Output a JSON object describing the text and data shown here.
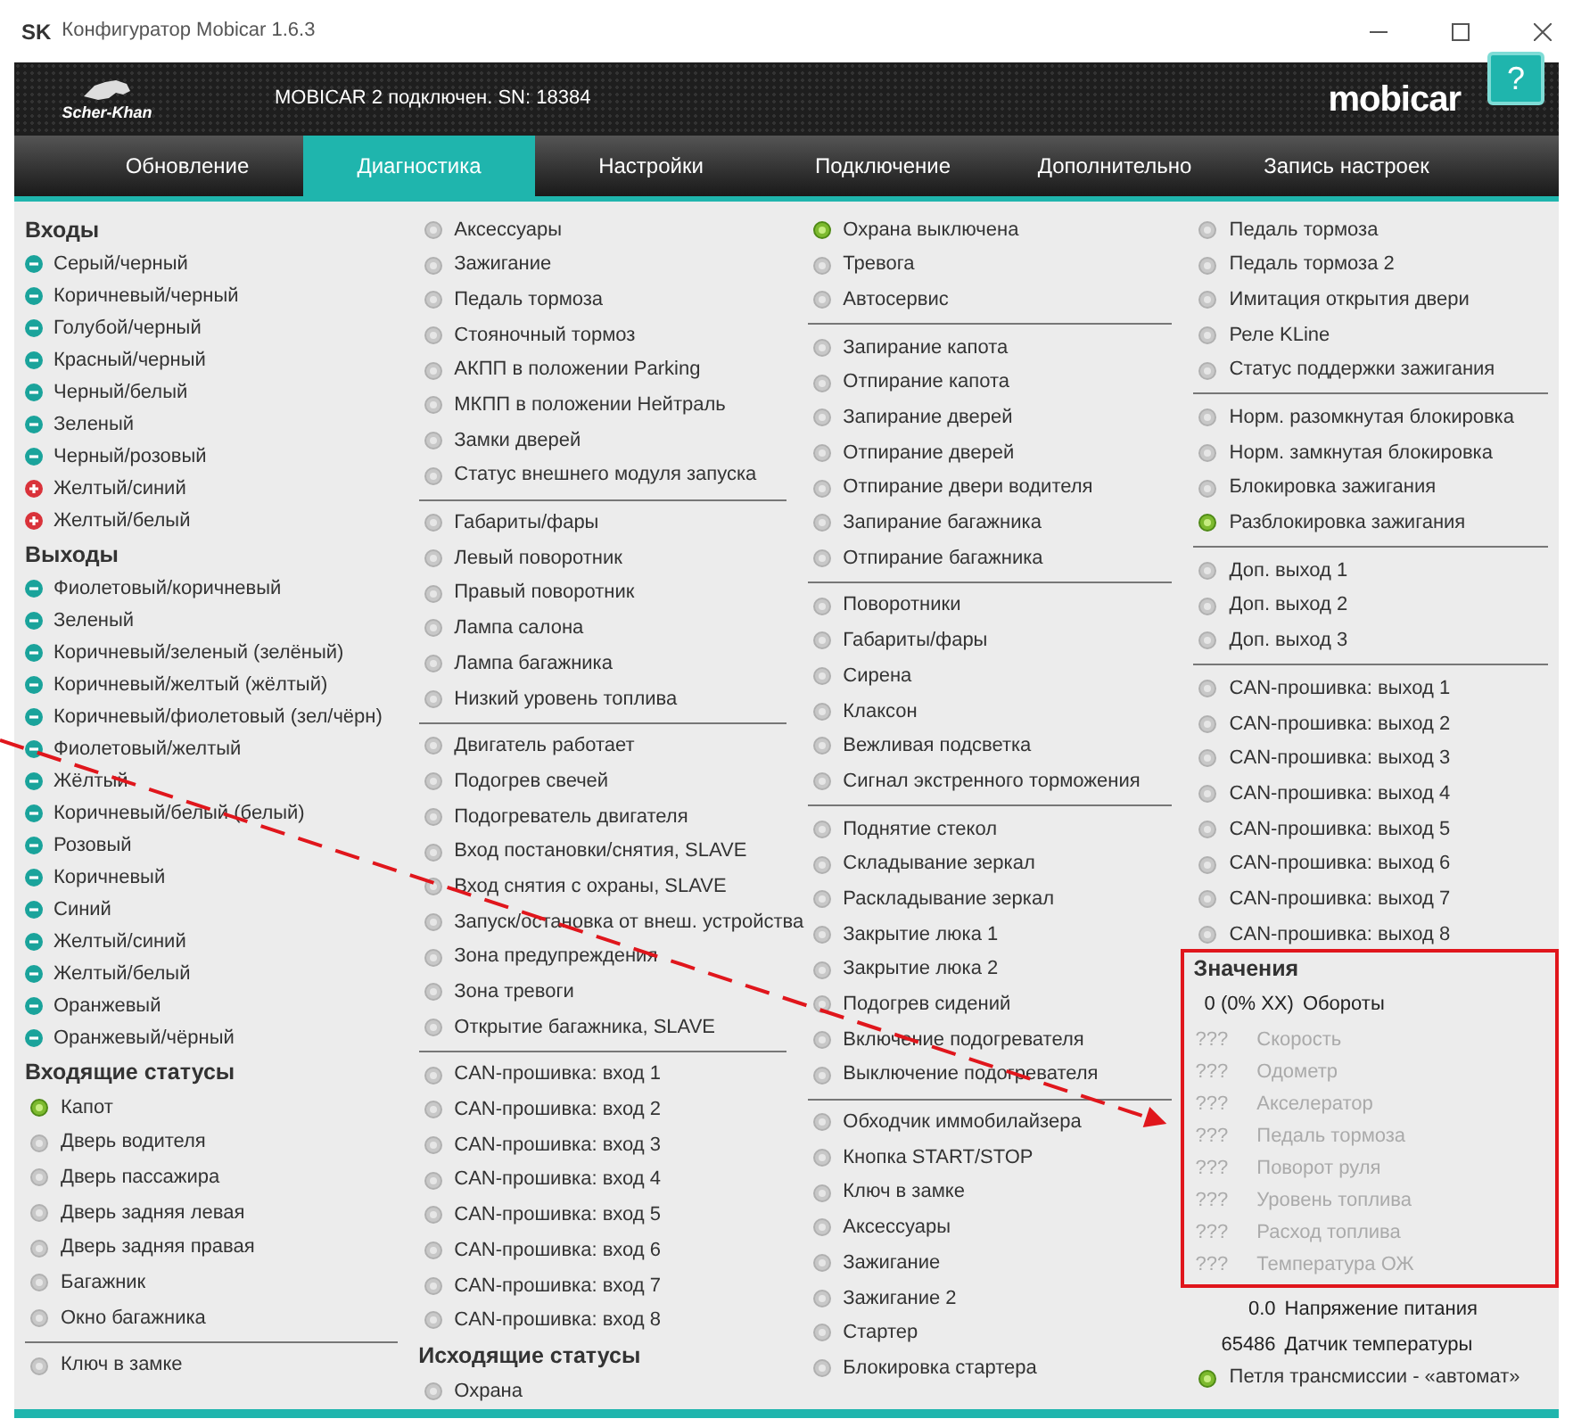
{
  "window": {
    "logo": "SK",
    "title": "Конфигуратор Mobicar 1.6.3"
  },
  "header": {
    "brand": "Scher-Khan",
    "status": "MOBICAR 2 подключен. SN: 18384",
    "product": "mobicar",
    "help": "?"
  },
  "tabs": [
    {
      "label": "Обновление",
      "selected": false
    },
    {
      "label": "Диагностика",
      "selected": true
    },
    {
      "label": "Настройки",
      "selected": false
    },
    {
      "label": "Подключение",
      "selected": false
    },
    {
      "label": "Дополнительно",
      "selected": false
    },
    {
      "label": "Запись настроек",
      "selected": false
    }
  ],
  "columns": [
    {
      "sections": [
        {
          "heading": "Входы",
          "items": [
            {
              "kind": "wire",
              "positive": false,
              "label": "Серый/черный"
            },
            {
              "kind": "wire",
              "positive": false,
              "label": "Коричневый/черный"
            },
            {
              "kind": "wire",
              "positive": false,
              "label": "Голубой/черный"
            },
            {
              "kind": "wire",
              "positive": false,
              "label": "Красный/черный"
            },
            {
              "kind": "wire",
              "positive": false,
              "label": "Черный/белый"
            },
            {
              "kind": "wire",
              "positive": false,
              "label": "Зеленый"
            },
            {
              "kind": "wire",
              "positive": false,
              "label": "Черный/розовый"
            },
            {
              "kind": "wire",
              "positive": true,
              "label": "Желтый/синий"
            },
            {
              "kind": "wire",
              "positive": true,
              "label": "Желтый/белый"
            }
          ]
        },
        {
          "heading": "Выходы",
          "items": [
            {
              "kind": "wire",
              "positive": false,
              "label": "Фиолетовый/коричневый"
            },
            {
              "kind": "wire",
              "positive": false,
              "label": "Зеленый"
            },
            {
              "kind": "wire",
              "positive": false,
              "label": "Коричневый/зеленый (зелёный)"
            },
            {
              "kind": "wire",
              "positive": false,
              "label": "Коричневый/желтый (жёлтый)"
            },
            {
              "kind": "wire",
              "positive": false,
              "label": "Коричневый/фиолетовый (зел/чёрн)"
            },
            {
              "kind": "wire",
              "positive": false,
              "label": "Фиолетовый/желтый"
            },
            {
              "kind": "wire",
              "positive": false,
              "label": "Жёлтый"
            },
            {
              "kind": "wire",
              "positive": false,
              "label": "Коричневый/белый (белый)"
            },
            {
              "kind": "wire",
              "positive": false,
              "label": "Розовый"
            },
            {
              "kind": "wire",
              "positive": false,
              "label": "Коричневый"
            },
            {
              "kind": "wire",
              "positive": false,
              "label": "Синий"
            },
            {
              "kind": "wire",
              "positive": false,
              "label": "Желтый/синий"
            },
            {
              "kind": "wire",
              "positive": false,
              "label": "Желтый/белый"
            },
            {
              "kind": "wire",
              "positive": false,
              "label": "Оранжевый"
            },
            {
              "kind": "wire",
              "positive": false,
              "label": "Оранжевый/чёрный"
            }
          ]
        },
        {
          "heading": "Входящие статусы",
          "items": [
            {
              "kind": "led",
              "on": true,
              "label": "Капот"
            },
            {
              "kind": "led",
              "on": false,
              "label": "Дверь водителя"
            },
            {
              "kind": "led",
              "on": false,
              "label": "Дверь пассажира"
            },
            {
              "kind": "led",
              "on": false,
              "label": "Дверь задняя левая"
            },
            {
              "kind": "led",
              "on": false,
              "label": "Дверь задняя правая"
            },
            {
              "kind": "led",
              "on": false,
              "label": "Багажник"
            },
            {
              "kind": "led",
              "on": false,
              "label": "Окно багажника"
            }
          ]
        },
        {
          "items": [
            {
              "kind": "led",
              "on": false,
              "label": "Ключ в замке"
            }
          ]
        }
      ]
    },
    {
      "sections": [
        {
          "items": [
            {
              "kind": "led",
              "on": false,
              "label": "Аксессуары"
            },
            {
              "kind": "led",
              "on": false,
              "label": "Зажигание"
            },
            {
              "kind": "led",
              "on": false,
              "label": "Педаль тормоза"
            },
            {
              "kind": "led",
              "on": false,
              "label": "Стояночный тормоз"
            },
            {
              "kind": "led",
              "on": false,
              "label": "АКПП в положении Parking"
            },
            {
              "kind": "led",
              "on": false,
              "label": "МКПП в положении Нейтраль"
            },
            {
              "kind": "led",
              "on": false,
              "label": "Замки дверей"
            },
            {
              "kind": "led",
              "on": false,
              "label": "Статус внешнего модуля запуска"
            }
          ]
        },
        {
          "items": [
            {
              "kind": "led",
              "on": false,
              "label": "Габариты/фары"
            },
            {
              "kind": "led",
              "on": false,
              "label": "Левый поворотник"
            },
            {
              "kind": "led",
              "on": false,
              "label": "Правый поворотник"
            },
            {
              "kind": "led",
              "on": false,
              "label": "Лампа салона"
            },
            {
              "kind": "led",
              "on": false,
              "label": "Лампа багажника"
            },
            {
              "kind": "led",
              "on": false,
              "label": "Низкий уровень топлива"
            }
          ]
        },
        {
          "items": [
            {
              "kind": "led",
              "on": false,
              "label": "Двигатель работает"
            },
            {
              "kind": "led",
              "on": false,
              "label": "Подогрев свечей"
            },
            {
              "kind": "led",
              "on": false,
              "label": "Подогреватель двигателя"
            },
            {
              "kind": "led",
              "on": false,
              "label": "Вход постановки/снятия, SLAVE"
            },
            {
              "kind": "led",
              "on": false,
              "label": "Вход снятия с охраны, SLAVE"
            },
            {
              "kind": "led",
              "on": false,
              "label": "Запуск/остановка от внеш. устройства"
            },
            {
              "kind": "led",
              "on": false,
              "label": "Зона предупреждения"
            },
            {
              "kind": "led",
              "on": false,
              "label": "Зона тревоги"
            },
            {
              "kind": "led",
              "on": false,
              "label": "Открытие багажника, SLAVE"
            }
          ]
        },
        {
          "items": [
            {
              "kind": "led",
              "on": false,
              "label": "CAN-прошивка: вход 1"
            },
            {
              "kind": "led",
              "on": false,
              "label": "CAN-прошивка: вход 2"
            },
            {
              "kind": "led",
              "on": false,
              "label": "CAN-прошивка: вход 3"
            },
            {
              "kind": "led",
              "on": false,
              "label": "CAN-прошивка: вход 4"
            },
            {
              "kind": "led",
              "on": false,
              "label": "CAN-прошивка: вход 5"
            },
            {
              "kind": "led",
              "on": false,
              "label": "CAN-прошивка: вход 6"
            },
            {
              "kind": "led",
              "on": false,
              "label": "CAN-прошивка: вход 7"
            },
            {
              "kind": "led",
              "on": false,
              "label": "CAN-прошивка: вход 8"
            }
          ]
        },
        {
          "heading": "Исходящие статусы",
          "items": [
            {
              "kind": "led",
              "on": false,
              "label": "Охрана"
            }
          ]
        }
      ]
    },
    {
      "sections": [
        {
          "items": [
            {
              "kind": "led",
              "on": true,
              "label": "Охрана выключена"
            },
            {
              "kind": "led",
              "on": false,
              "label": "Тревога"
            },
            {
              "kind": "led",
              "on": false,
              "label": "Автосервис"
            }
          ]
        },
        {
          "items": [
            {
              "kind": "led",
              "on": false,
              "label": "Запирание капота"
            },
            {
              "kind": "led",
              "on": false,
              "label": "Отпирание капота"
            },
            {
              "kind": "led",
              "on": false,
              "label": "Запирание дверей"
            },
            {
              "kind": "led",
              "on": false,
              "label": "Отпирание дверей"
            },
            {
              "kind": "led",
              "on": false,
              "label": "Отпирание двери водителя"
            },
            {
              "kind": "led",
              "on": false,
              "label": "Запирание багажника"
            },
            {
              "kind": "led",
              "on": false,
              "label": "Отпирание багажника"
            }
          ]
        },
        {
          "items": [
            {
              "kind": "led",
              "on": false,
              "label": "Поворотники"
            },
            {
              "kind": "led",
              "on": false,
              "label": "Габариты/фары"
            },
            {
              "kind": "led",
              "on": false,
              "label": "Сирена"
            },
            {
              "kind": "led",
              "on": false,
              "label": "Клаксон"
            },
            {
              "kind": "led",
              "on": false,
              "label": "Вежливая подсветка"
            },
            {
              "kind": "led",
              "on": false,
              "label": "Сигнал экстренного торможения"
            }
          ]
        },
        {
          "items": [
            {
              "kind": "led",
              "on": false,
              "label": "Поднятие стекол"
            },
            {
              "kind": "led",
              "on": false,
              "label": "Складывание зеркал"
            },
            {
              "kind": "led",
              "on": false,
              "label": "Раскладывание зеркал"
            },
            {
              "kind": "led",
              "on": false,
              "label": "Закрытие люка 1"
            },
            {
              "kind": "led",
              "on": false,
              "label": "Закрытие люка 2"
            },
            {
              "kind": "led",
              "on": false,
              "label": "Подогрев сидений"
            },
            {
              "kind": "led",
              "on": false,
              "label": "Включение подогревателя"
            },
            {
              "kind": "led",
              "on": false,
              "label": "Выключение подогревателя"
            }
          ]
        },
        {
          "items": [
            {
              "kind": "led",
              "on": false,
              "label": "Обходчик иммобилайзера"
            },
            {
              "kind": "led",
              "on": false,
              "label": "Кнопка START/STOP"
            },
            {
              "kind": "led",
              "on": false,
              "label": "Ключ в замке"
            },
            {
              "kind": "led",
              "on": false,
              "label": "Аксессуары"
            },
            {
              "kind": "led",
              "on": false,
              "label": "Зажигание"
            },
            {
              "kind": "led",
              "on": false,
              "label": "Зажигание 2"
            },
            {
              "kind": "led",
              "on": false,
              "label": "Стартер"
            },
            {
              "kind": "led",
              "on": false,
              "label": "Блокировка стартера"
            }
          ]
        }
      ]
    },
    {
      "sections": [
        {
          "items": [
            {
              "kind": "led",
              "on": false,
              "label": "Педаль тормоза"
            },
            {
              "kind": "led",
              "on": false,
              "label": "Педаль тормоза 2"
            },
            {
              "kind": "led",
              "on": false,
              "label": "Имитация открытия двери"
            },
            {
              "kind": "led",
              "on": false,
              "label": "Реле KLine"
            },
            {
              "kind": "led",
              "on": false,
              "label": "Статус поддержки зажигания"
            }
          ]
        },
        {
          "items": [
            {
              "kind": "led",
              "on": false,
              "label": "Норм. разомкнутая блокировка"
            },
            {
              "kind": "led",
              "on": false,
              "label": "Норм. замкнутая блокировка"
            },
            {
              "kind": "led",
              "on": false,
              "label": "Блокировка зажигания"
            },
            {
              "kind": "led",
              "on": true,
              "label": "Разблокировка зажигания"
            }
          ]
        },
        {
          "items": [
            {
              "kind": "led",
              "on": false,
              "label": "Доп. выход 1"
            },
            {
              "kind": "led",
              "on": false,
              "label": "Доп. выход 2"
            },
            {
              "kind": "led",
              "on": false,
              "label": "Доп. выход 3"
            }
          ]
        },
        {
          "items": [
            {
              "kind": "led",
              "on": false,
              "label": "CAN-прошивка: выход 1"
            },
            {
              "kind": "led",
              "on": false,
              "label": "CAN-прошивка: выход 2"
            },
            {
              "kind": "led",
              "on": false,
              "label": "CAN-прошивка: выход 3"
            },
            {
              "kind": "led",
              "on": false,
              "label": "CAN-прошивка: выход 4"
            },
            {
              "kind": "led",
              "on": false,
              "label": "CAN-прошивка: выход 5"
            },
            {
              "kind": "led",
              "on": false,
              "label": "CAN-прошивка: выход 6"
            },
            {
              "kind": "led",
              "on": false,
              "label": "CAN-прошивка: выход 7"
            },
            {
              "kind": "led",
              "on": false,
              "label": "CAN-прошивка: выход 8"
            }
          ]
        },
        {
          "heading": "Значения",
          "highlighted": true,
          "items": [
            {
              "kind": "value",
              "available": true,
              "reading": "0 (0% XX)",
              "label": "Обороты"
            },
            {
              "kind": "value",
              "available": false,
              "reading": "???",
              "label": "Скорость"
            },
            {
              "kind": "value",
              "available": false,
              "reading": "???",
              "label": "Одометр"
            },
            {
              "kind": "value",
              "available": false,
              "reading": "???",
              "label": "Акселератор"
            },
            {
              "kind": "value",
              "available": false,
              "reading": "???",
              "label": "Педаль тормоза"
            },
            {
              "kind": "value",
              "available": false,
              "reading": "???",
              "label": "Поворот руля"
            },
            {
              "kind": "value",
              "available": false,
              "reading": "???",
              "label": "Уровень топлива"
            },
            {
              "kind": "value",
              "available": false,
              "reading": "???",
              "label": "Расход топлива"
            },
            {
              "kind": "value",
              "available": false,
              "reading": "???",
              "label": "Температура ОЖ"
            }
          ]
        },
        {
          "items": [
            {
              "kind": "value",
              "available": true,
              "reading": "0.0",
              "label": "Напряжение питания"
            },
            {
              "kind": "value",
              "available": true,
              "reading": "65486",
              "label": "Датчик температуры"
            },
            {
              "kind": "led",
              "on": true,
              "label": "Петля трансмиссии - «автомат»"
            }
          ]
        }
      ]
    }
  ]
}
